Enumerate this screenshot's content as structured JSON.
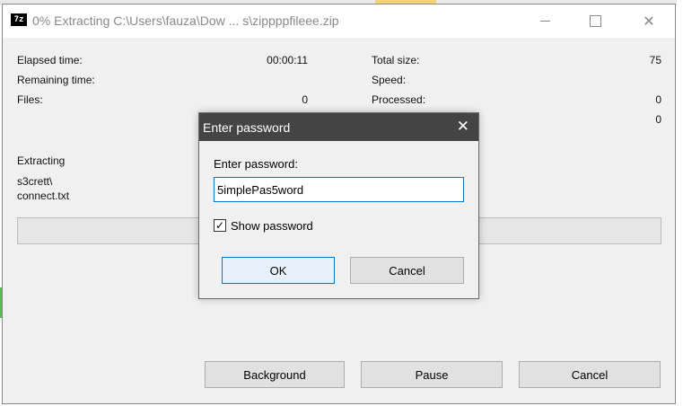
{
  "window": {
    "title": "0% Extracting C:\\Users\\fauza\\Dow ... s\\zippppfileee.zip",
    "app_icon": "7z"
  },
  "stats": {
    "elapsed_label": "Elapsed time:",
    "elapsed_value": "00:00:11",
    "remaining_label": "Remaining time:",
    "files_label": "Files:",
    "files_value": "0",
    "total_size_label": "Total size:",
    "total_size_value": "75",
    "speed_label": "Speed:",
    "processed_label": "Processed:",
    "processed_value": "0",
    "extra_value": "0"
  },
  "current": {
    "action": "Extracting",
    "path_line1": "s3crett\\",
    "path_line2": "connect.txt"
  },
  "progress_percent": 0,
  "buttons": {
    "background": "Background",
    "pause": "Pause",
    "cancel": "Cancel"
  },
  "dialog": {
    "title": "Enter password",
    "label": "Enter password:",
    "password_value": "5implePas5word",
    "show_password_label": "Show password",
    "show_password_checked": true,
    "ok": "OK",
    "cancel": "Cancel"
  }
}
